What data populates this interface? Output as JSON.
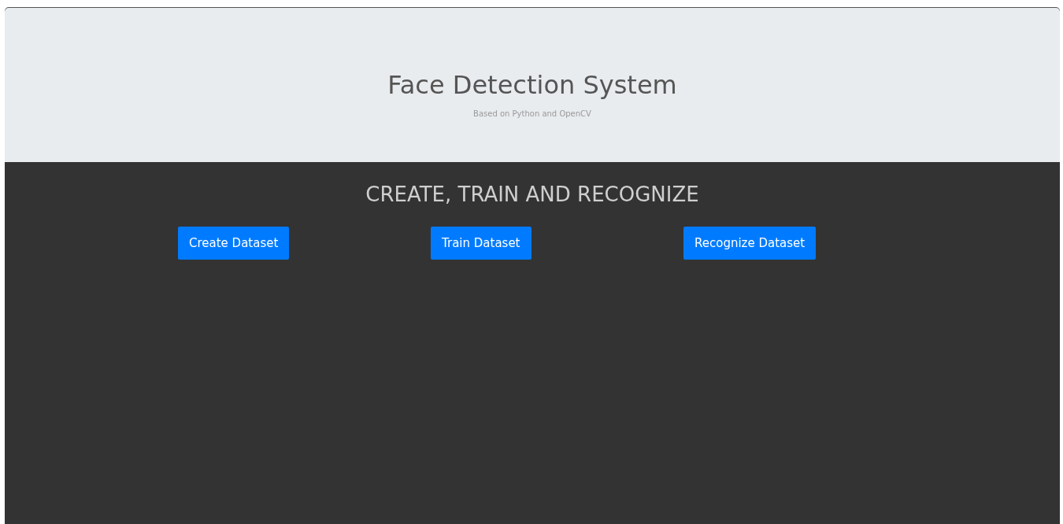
{
  "header": {
    "title": "Face Detection System",
    "subtitle": "Based on Python and OpenCV"
  },
  "section": {
    "heading": "CREATE, TRAIN AND RECOGNIZE"
  },
  "buttons": [
    {
      "label": "Create Dataset"
    },
    {
      "label": "Train Dataset"
    },
    {
      "label": "Recognize Dataset"
    }
  ]
}
